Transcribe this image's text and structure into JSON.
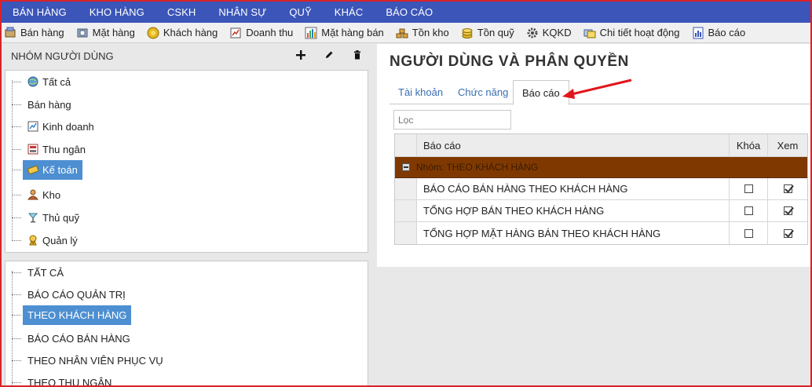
{
  "top_menu": [
    "BÁN HÀNG",
    "KHO HÀNG",
    "CSKH",
    "NHÂN SỰ",
    "QUỸ",
    "KHÁC",
    "BÁO CÁO"
  ],
  "toolbar": [
    {
      "label": "Bán hàng",
      "icon": "sales-icon"
    },
    {
      "label": "Mặt hàng",
      "icon": "product-icon"
    },
    {
      "label": "Khách hàng",
      "icon": "customer-icon"
    },
    {
      "label": "Doanh thu",
      "icon": "revenue-icon"
    },
    {
      "label": "Mặt hàng bán",
      "icon": "bar-chart-icon"
    },
    {
      "label": "Tồn kho",
      "icon": "stock-icon"
    },
    {
      "label": "Tồn quỹ",
      "icon": "coins-icon"
    },
    {
      "label": "KQKD",
      "icon": "gear-icon"
    },
    {
      "label": "Chi tiết hoạt động",
      "icon": "activity-icon"
    },
    {
      "label": "Báo cáo",
      "icon": "report-icon"
    }
  ],
  "left": {
    "header": "NHÓM NGƯỜI DÙNG",
    "groups": [
      {
        "label": "Tất cả",
        "icon": "globe-icon"
      },
      {
        "label": "Bán hàng",
        "icon": ""
      },
      {
        "label": "Kinh doanh",
        "icon": "business-icon"
      },
      {
        "label": "Thu ngân",
        "icon": "cashier-icon"
      },
      {
        "label": "Kế toán",
        "icon": "accounting-icon",
        "selected": true
      },
      {
        "label": "Kho",
        "icon": "warehouse-icon"
      },
      {
        "label": "Thủ quỹ",
        "icon": "treasurer-icon"
      },
      {
        "label": "Quản lý",
        "icon": "manager-icon"
      }
    ],
    "report_groups": [
      {
        "label": "TẤT CẢ"
      },
      {
        "label": "BÁO CÁO QUẢN TRỊ"
      },
      {
        "label": "THEO KHÁCH HÀNG",
        "selected": true
      },
      {
        "label": "BÁO CÁO BÁN HÀNG"
      },
      {
        "label": "THEO NHÂN VIÊN PHỤC VỤ"
      },
      {
        "label": "THEO THU NGÂN"
      }
    ]
  },
  "main": {
    "title": "NGƯỜI DÙNG VÀ PHÂN QUYỀN",
    "tabs": [
      {
        "label": "Tài khoản"
      },
      {
        "label": "Chức năng"
      },
      {
        "label": "Báo cáo",
        "active": true
      }
    ],
    "filter_placeholder": "Lọc",
    "grid": {
      "headers": {
        "name": "Báo cáo",
        "lock": "Khóa",
        "view": "Xem"
      },
      "group_label": "Nhóm: THEO KHÁCH HÀNG",
      "rows": [
        {
          "name": "BÁO CÁO BÁN HÀNG THEO KHÁCH HÀNG",
          "lock": false,
          "view": true
        },
        {
          "name": "TỔNG HỢP BÁN THEO KHÁCH HÀNG",
          "lock": false,
          "view": true
        },
        {
          "name": "TỔNG HỢP MẶT HÀNG BÁN THEO KHÁCH HÀNG",
          "lock": false,
          "view": true
        }
      ]
    }
  },
  "colors": {
    "menu_bg": "#3b55b8",
    "selected_bg": "#4d8fd1",
    "group_row_bg": "#7f3900",
    "annotation_arrow": "#e0161c"
  }
}
